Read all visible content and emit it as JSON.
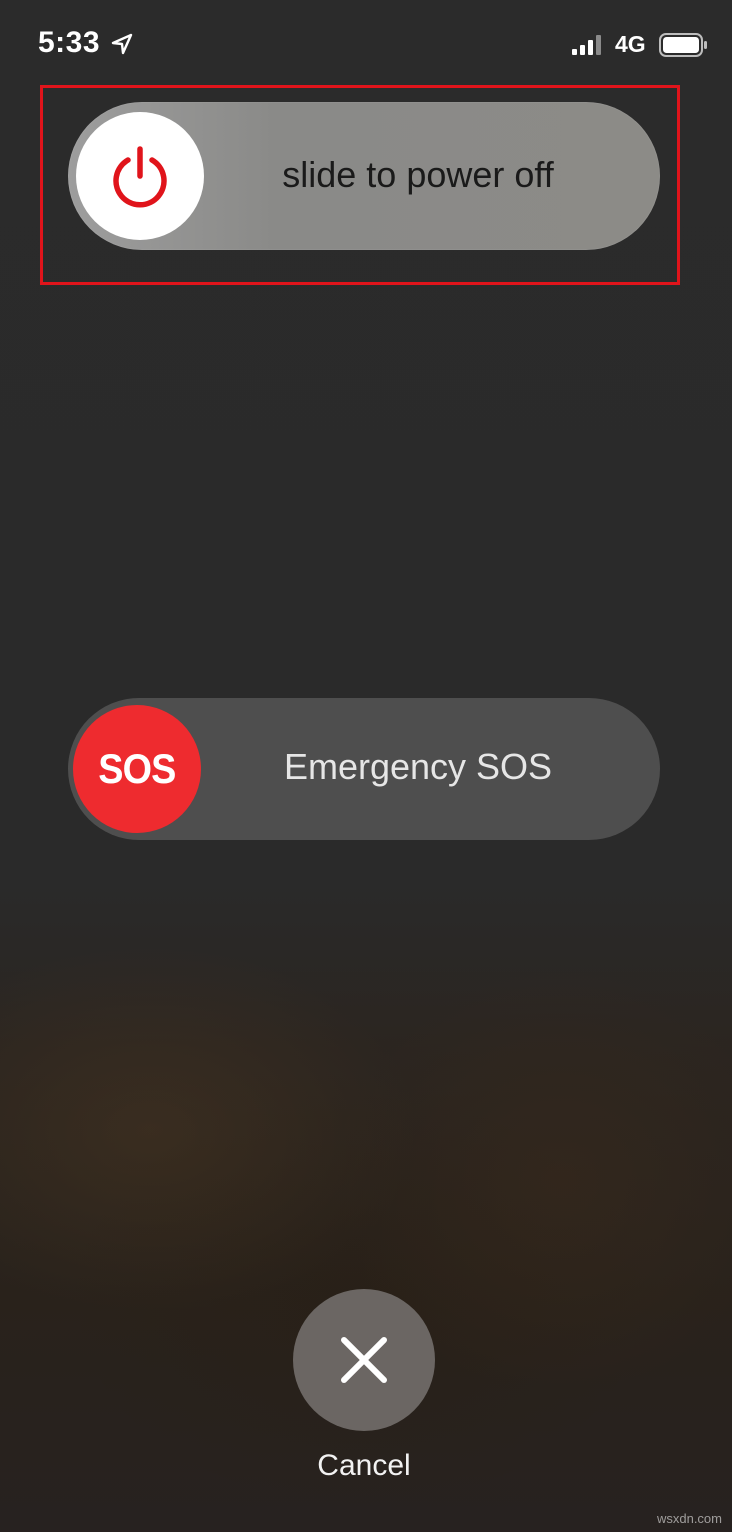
{
  "status_bar": {
    "time": "5:33",
    "network": "4G",
    "icons": [
      "location-arrow-icon",
      "signal-bars-icon",
      "battery-icon"
    ]
  },
  "power": {
    "label": "slide to power off",
    "knob_icon": "power-icon",
    "icon_color": "#e0141b"
  },
  "sos": {
    "knob_text": "SOS",
    "label": "Emergency SOS",
    "knob_color": "#ee2b2f"
  },
  "cancel": {
    "label": "Cancel",
    "icon": "close-icon"
  },
  "highlight": {
    "color": "#e0141b"
  },
  "watermark": "wsxdn.com"
}
